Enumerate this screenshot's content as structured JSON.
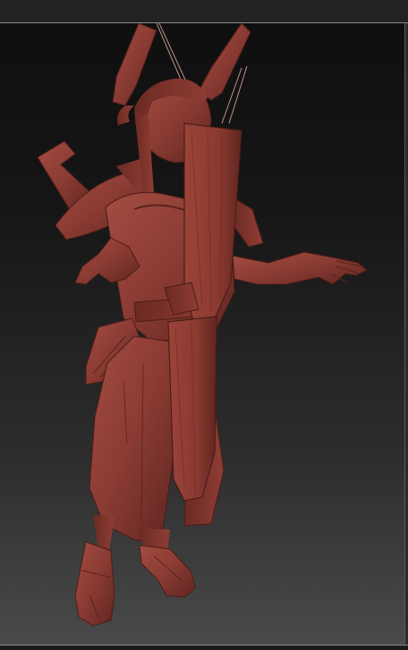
{
  "viewport": {
    "material_color": "#8a3b33",
    "material_shadow": "#4d1c17",
    "material_highlight": "#b0594e",
    "background_top": "#0f0f0f",
    "background_bottom": "#4a4a4a"
  },
  "model": {
    "icon": "sculpt-model"
  }
}
